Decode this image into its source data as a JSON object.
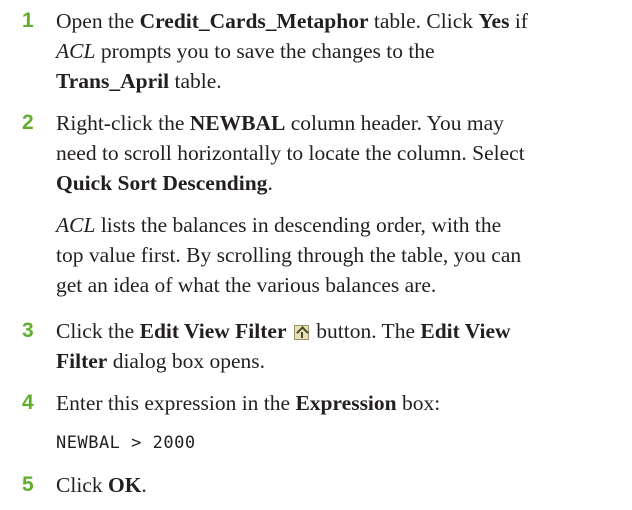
{
  "steps": [
    {
      "num": "1",
      "p1": "Open the ",
      "b1": "Credit_Cards_Metaphor",
      "p2": " table. Click ",
      "b2": "Yes",
      "p3": " if",
      "i1": "ACL",
      "p4": " prompts you to save the changes to the",
      "b3": "Trans_April",
      "p5": " table."
    },
    {
      "num": "2",
      "p1": "Right-click the ",
      "b1": "NEWBAL",
      "p2": " column header. You may",
      "p3": "need to scroll horizontally to locate the column. Select",
      "b2": "Quick Sort Descending",
      "p4": ".",
      "note_i": "ACL",
      "note_line1": " lists the balances in descending order, with the",
      "note_line2": "top value first. By scrolling through the table, you can",
      "note_line3": "get an idea of what the various balances are."
    },
    {
      "num": "3",
      "p1": "Click the ",
      "b1": "Edit View Filter",
      "icon": "edit-view-filter-icon",
      "p2": " button. The ",
      "b2": "Edit View",
      "b3": "Filter",
      "p3": " dialog box opens."
    },
    {
      "num": "4",
      "p1": "Enter this expression in the ",
      "b1": "Expression",
      "p2": " box:",
      "code": "NEWBAL > 2000"
    },
    {
      "num": "5",
      "p1": "Click ",
      "b1": "OK",
      "p2": "."
    }
  ]
}
